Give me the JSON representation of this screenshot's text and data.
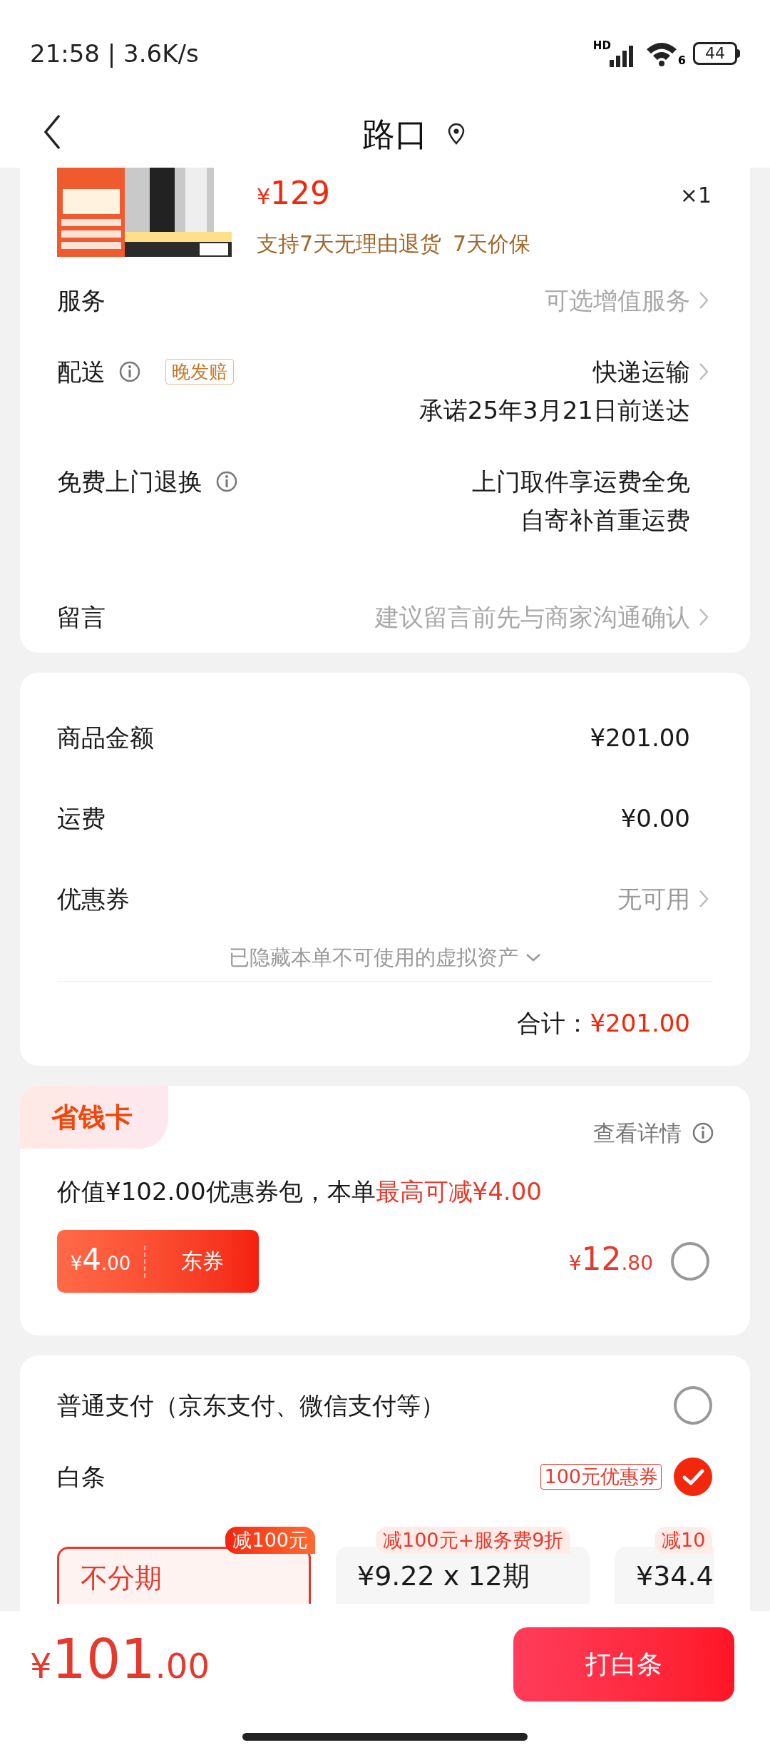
{
  "status_bar": {
    "time": "21:58",
    "separator": "|",
    "speed": "3.6K/s",
    "network_label": "HD",
    "wifi_label": "6",
    "battery": "44"
  },
  "header": {
    "title": "路口"
  },
  "product": {
    "price_symbol": "¥",
    "price": "129",
    "quantity": "×1",
    "guarantees": [
      "支持7天无理由退货",
      "7天价保"
    ]
  },
  "order_rows": [
    {
      "label": "服务",
      "info": false,
      "value_lines": [
        "可选增值服务"
      ],
      "muted": true,
      "chevron": true
    },
    {
      "label": "配送",
      "info": true,
      "tag": "晚发赔",
      "value_lines": [
        "快递运输",
        "承诺25年3月21日前送达"
      ],
      "muted": false,
      "chevron": true
    },
    {
      "label": "免费上门退换",
      "info": true,
      "value_lines": [
        "上门取件享运费全免",
        "自寄补首重运费"
      ],
      "muted": false,
      "chevron": false
    },
    {
      "label": "留言",
      "info": false,
      "value_lines": [
        "建议留言前先与商家沟通确认"
      ],
      "muted": true,
      "chevron": true
    }
  ],
  "summary": {
    "rows": [
      {
        "label": "商品金额",
        "value": "¥201.00",
        "muted": false,
        "chevron": false
      },
      {
        "label": "运费",
        "value": "¥0.00",
        "muted": false,
        "chevron": false
      },
      {
        "label": "优惠券",
        "value": "无可用",
        "muted": true,
        "chevron": true
      }
    ],
    "hidden_assets": "已隐藏本单不可使用的虚拟资产",
    "total_label": "合计：",
    "total": "¥201.00"
  },
  "savings_card": {
    "title": "省钱卡",
    "details": "查看详情",
    "description": "价值¥102.00优惠券包，本单",
    "description_highlight": "最高可减¥4.00",
    "coupon": {
      "symbol": "¥",
      "amount": "4",
      "decimals": ".00",
      "label": "东券"
    },
    "price": {
      "symbol": "¥",
      "integer": "12",
      "decimals": ".80"
    },
    "selected": false
  },
  "payment": {
    "methods": [
      {
        "label": "普通支付（京东支付、微信支付等）",
        "selected": false
      },
      {
        "label": "白条",
        "badge": "100元优惠券",
        "selected": true
      }
    ],
    "plans": [
      {
        "tag": "减100元",
        "title": "不分期",
        "selected": true
      },
      {
        "tag": "减100元+服务费9折",
        "title": "¥9.22 x 12期",
        "selected": false
      },
      {
        "tag": "减10",
        "title": "¥34.4",
        "selected": false
      }
    ]
  },
  "bottom_bar": {
    "symbol": "¥",
    "integer": "101",
    "decimals": ".00",
    "button": "打白条"
  }
}
